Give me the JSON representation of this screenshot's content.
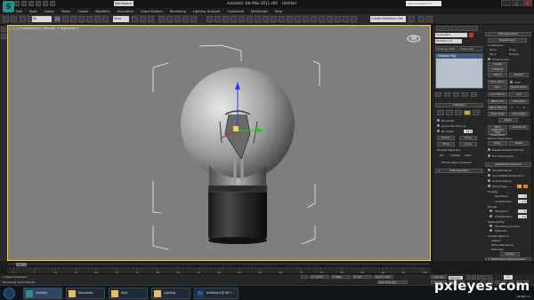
{
  "titlebar": {
    "app_logo": "S",
    "workspace": "Workspace",
    "title": "Autodesk 3ds Max 2011 x64",
    "doc_title": "Untitled",
    "search_placeholder": "Type a keyword or phrase"
  },
  "menu": [
    "Edit",
    "Tools",
    "Group",
    "Views",
    "Create",
    "Modifiers",
    "Animation",
    "Graph Editors",
    "Rendering",
    "Lighting Analysis",
    "Customize",
    "MAXScript",
    "Help"
  ],
  "toolbar": {
    "filter": "All",
    "coord": "View",
    "named_sel": "Create Selection Set"
  },
  "viewport": {
    "label": "[ + ] [ Perspective ] [ Smooth + Highlights ]",
    "object": "lightbulb"
  },
  "cmdpanel": {
    "object_name": "Sphere001",
    "modifier_list": "Modifier List",
    "stack_btn_1": "Unwrap UVW",
    "stack_btn_2": "Uvw map",
    "stack_item": "Editable Poly",
    "edit_geometry": "Edit Geometry",
    "repeat_last": "Repeat Last",
    "constraints": "Constraints",
    "c_none": "None",
    "c_edge": "Edge",
    "c_face": "Face",
    "c_normal": "Normal",
    "preserve_uvs": "Preserve UVs",
    "create": "Create",
    "collapse": "Collapse",
    "attach": "Attach",
    "detach": "Detach",
    "slice_plane": "Slice Plane",
    "split": "Split",
    "slice": "Slice",
    "reset_plane": "Reset Plane",
    "quickslice": "QuickSlice",
    "cut": "Cut",
    "msmooth": "MSmooth",
    "tessellate": "Tessellate",
    "make_planar": "Make Planar",
    "x": "X",
    "y": "Y",
    "z": "Z",
    "view_align": "View Align",
    "grid_align": "Grid Align",
    "relax": "Relax",
    "hide_selected": "Hide Selected",
    "unhide_all": "Unhide All",
    "hide_unselected": "Hide Unselected",
    "named_selections": "Named Selections:",
    "copy": "Copy",
    "paste": "Paste",
    "delete_isolated": "Delete Isolated Vertices",
    "full_interactivity": "Full Interactivity",
    "selection": "Selection",
    "by_vertex": "By Vertex",
    "ignore_backfacing": "Ignore Backfacing",
    "by_angle": "By Angle:",
    "by_angle_val": "45.0",
    "shrink": "Shrink",
    "grow": "Grow",
    "ring": "Ring",
    "loop": "Loop",
    "preview_selection": "Preview Selection",
    "preview_off": "Off",
    "subobj": "SubObj",
    "multi": "Multi",
    "whole_object": "Whole Object Selected",
    "soft_selection": "Soft Selection",
    "subdivision_surface": "Subdivision Surface",
    "smooth_result": "Smooth Result",
    "use_nurms": "Use NURMS Subdivision",
    "isoline_display": "Isoline Display",
    "show_cage": "Show Cage......",
    "display": "Display",
    "iterations": "Iterations:",
    "iterations_val": "1",
    "smoothness": "Smoothness:",
    "smoothness_val": "1.0",
    "render": "Render",
    "iterations_r_val": "0",
    "smoothness_r_val": "1.0",
    "separate_by": "Separate By",
    "smoothing_groups": "Smoothing Groups",
    "materials": "Materials",
    "update_options": "Update Options",
    "always": "Always",
    "when_rendering": "When Rendering",
    "manually": "Manually",
    "update": "Update",
    "subdivision_displacement": "Subdivision Displacement",
    "cage_color_1": "#e8a020",
    "cage_color_2": "#d48a10"
  },
  "timeline": {
    "thumb": "0 / 100",
    "ticks": [
      "0",
      "5",
      "10",
      "15",
      "20",
      "25",
      "30",
      "35",
      "40",
      "45",
      "50",
      "55",
      "60",
      "65",
      "70",
      "75",
      "80",
      "85",
      "90",
      "95",
      "100"
    ]
  },
  "status": {
    "line1": "1 Object Selected",
    "line2": "Rendering Time  0:00:00",
    "x_label": "X:",
    "x_val": "-6.367",
    "y_label": "Y:",
    "y_val": "68.9",
    "z_label": "Z:",
    "z_val": "0.0",
    "grid": "Grid = 10.0",
    "auto_key": "Auto Key",
    "set_key": "Set Key",
    "selected": "Selected",
    "key_filters": "Key Filters...",
    "add_time_tag": "Add Time Tag",
    "frame": "0"
  },
  "taskbar": {
    "items": [
      "Untitled - Autodesk...",
      "Document",
      "Sky2",
      "Lighting",
      "Untitled-3 @ 66.7..."
    ],
    "time": "08 Nov 11"
  },
  "watermark": "pxleyes.com"
}
